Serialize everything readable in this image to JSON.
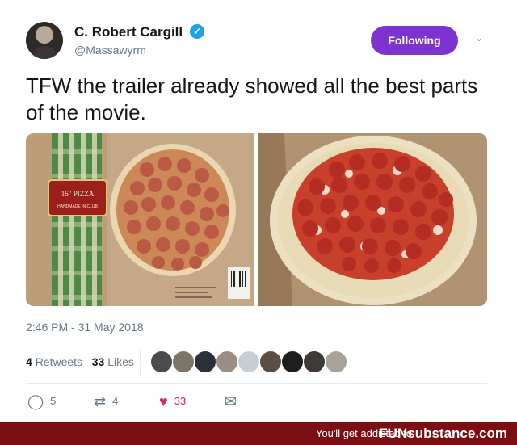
{
  "tweet": {
    "author_name": "C. Robert Cargill",
    "handle": "@Massawyrm",
    "follow_label": "Following",
    "text": "TFW the trailer already showed all the best parts of the movie.",
    "timestamp": "2:46 PM - 31 May 2018",
    "retweets_count": "4",
    "retweets_label": "Retweets",
    "likes_count": "33",
    "likes_label": "Likes",
    "actions": {
      "reply_count": "5",
      "retweet_count": "4",
      "like_count": "33"
    },
    "media": {
      "box_label_line1": "16\" PIZZA",
      "box_label_line2": "HANDMADE IN CLUB"
    }
  },
  "footer": {
    "tagline": "You'll get addicted to",
    "brand": "FUNsubstance.com"
  },
  "icons": [
    "verified-badge-icon",
    "chevron-down-icon",
    "reply-icon",
    "retweet-icon",
    "heart-icon",
    "message-icon"
  ],
  "colors": {
    "follow_button": "#7c33d0",
    "verified": "#1da1f2",
    "like": "#e0245e",
    "footer": "#7a0e12"
  }
}
